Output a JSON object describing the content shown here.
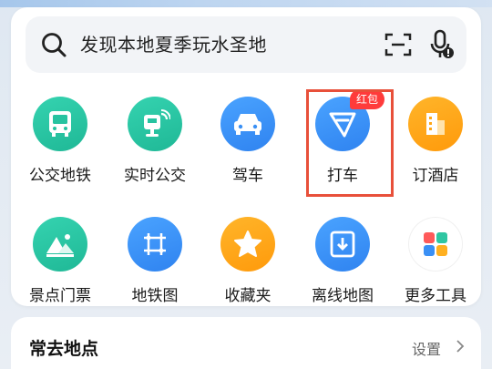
{
  "search": {
    "placeholder": "发现本地夏季玩水圣地"
  },
  "shortcuts": [
    {
      "label": "公交地铁",
      "icon": "bus-icon",
      "color": "teal"
    },
    {
      "label": "实时公交",
      "icon": "realtime-bus-icon",
      "color": "teal"
    },
    {
      "label": "驾车",
      "icon": "car-icon",
      "color": "blue"
    },
    {
      "label": "打车",
      "icon": "taxi-icon",
      "color": "blue",
      "badge": "红包"
    },
    {
      "label": "订酒店",
      "icon": "hotel-icon",
      "color": "orange"
    },
    {
      "label": "景点门票",
      "icon": "scenic-icon",
      "color": "teal"
    },
    {
      "label": "地铁图",
      "icon": "subway-map-icon",
      "color": "blue"
    },
    {
      "label": "收藏夹",
      "icon": "star-icon",
      "color": "orange"
    },
    {
      "label": "离线地图",
      "icon": "download-icon",
      "color": "blue"
    },
    {
      "label": "更多工具",
      "icon": "grid-icon",
      "color": "multi"
    }
  ],
  "frequent": {
    "title": "常去地点",
    "settings_label": "设置"
  },
  "colors": {
    "teal": "#26c3a0",
    "blue": "#3a90f5",
    "orange": "#ffa616",
    "highlight": "#e8503a",
    "badge": "#ff3b3b"
  }
}
